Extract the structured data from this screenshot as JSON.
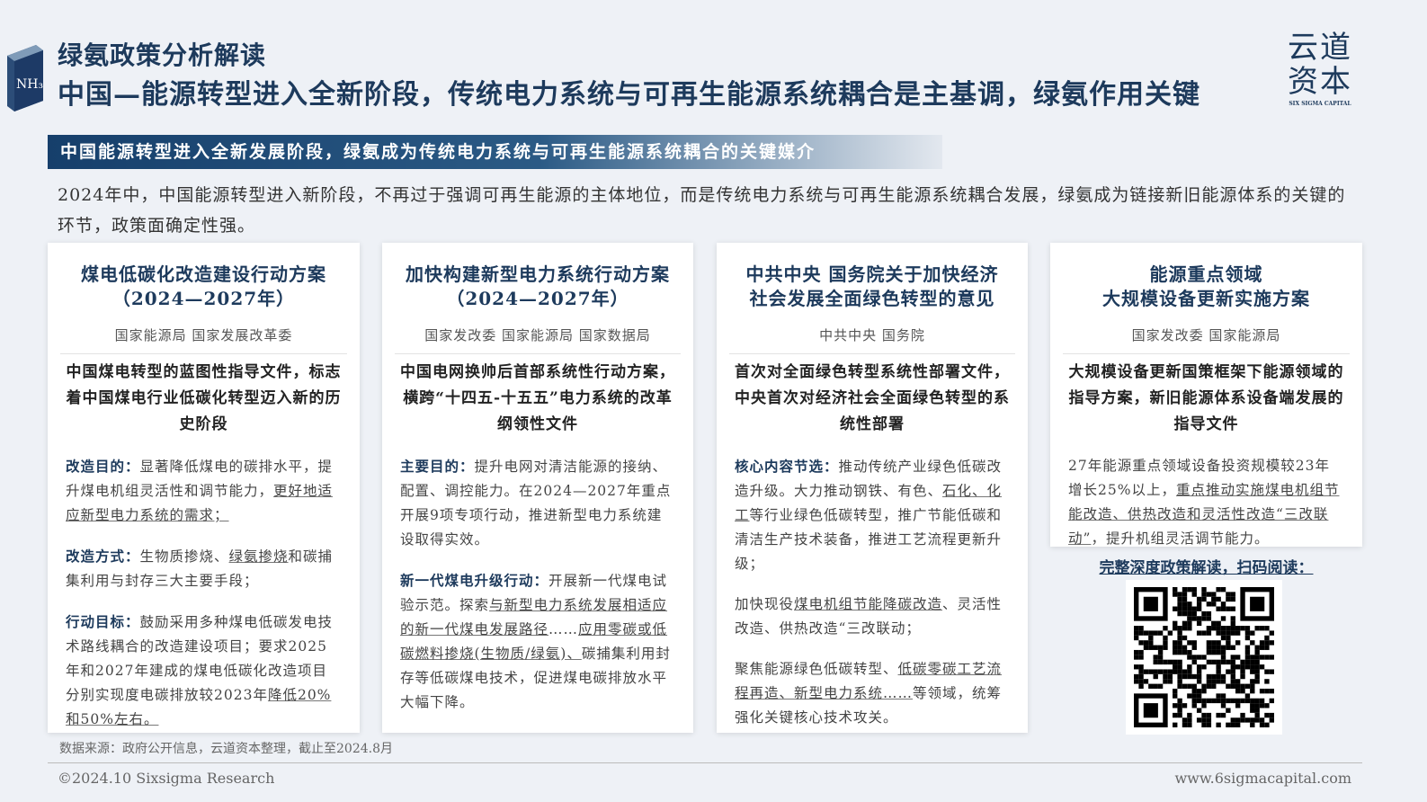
{
  "header": {
    "subtitle": "绿氨政策分析解读",
    "title": "中国—能源转型进入全新阶段，传统电力系统与可再生能源系统耦合是主基调，绿氨作用关键",
    "logo_badge": "NH₃"
  },
  "brand": {
    "cn_line1": "云道",
    "cn_line2": "资本",
    "en": "SIX SIGMA CAPITAL"
  },
  "banner": "中国能源转型进入全新发展阶段，绿氨成为传统电力系统与可再生能源系统耦合的关键媒介",
  "intro": "2024年中，中国能源转型进入新阶段，不再过于强调可再生能源的主体地位，而是传统电力系统与可再生能源系统耦合发展，绿氨成为链接新旧能源体系的关键的环节，政策面确定性强。",
  "cards": [
    {
      "title1": "煤电低碳化改造建设行动方案",
      "title2": "（2024—2027年）",
      "org": "国家能源局 国家发展改革委",
      "summary": "中国煤电转型的蓝图性指导文件，标志着中国煤电行业低碳化转型迈入新的历史阶段",
      "paras": [
        [
          {
            "t": "改造目的：",
            "s": "b"
          },
          {
            "t": "显著降低煤电的碳排水平，提升煤电机组灵活性和调节能力，"
          },
          {
            "t": "更好地适应新型电力系统的需求；",
            "s": "u"
          }
        ],
        [
          {
            "t": "改造方式：",
            "s": "b"
          },
          {
            "t": "生物质掺烧、"
          },
          {
            "t": "绿氨掺烧",
            "s": "u"
          },
          {
            "t": "和碳捕集利用与封存三大主要手段；"
          }
        ],
        [
          {
            "t": "行动目标：",
            "s": "b"
          },
          {
            "t": "鼓励采用多种煤电低碳发电技术路线耦合的改造建设项目；要求2025年和2027年建成的煤电低碳化改造项目分别实现度电碳排放较2023年"
          },
          {
            "t": "降低20%和50%左右。",
            "s": "u"
          }
        ]
      ]
    },
    {
      "title1": "加快构建新型电力系统行动方案",
      "title2": "（2024—2027年）",
      "org": "国家发改委 国家能源局 国家数据局",
      "summary": "中国电网换帅后首部系统性行动方案，横跨“十四五-十五五”电力系统的改革纲领性文件",
      "paras": [
        [
          {
            "t": "主要目的：",
            "s": "b"
          },
          {
            "t": "提升电网对清洁能源的接纳、配置、调控能力。在2024—2027年重点开展9项专项行动，推进新型电力系统建设取得实效。"
          }
        ],
        [
          {
            "t": "新一代煤电升级行动：",
            "s": "b"
          },
          {
            "t": "开展新一代煤电试验示范。探索"
          },
          {
            "t": "与新型电力系统发展相适应的新一代煤电发展路径",
            "s": "u"
          },
          {
            "t": "……"
          },
          {
            "t": "应用零碳或低碳燃料掺烧(生物质/绿氨)、",
            "s": "u"
          },
          {
            "t": "碳捕集利用封存等低碳煤电技术，促进煤电碳排放水平大幅下降。"
          }
        ]
      ]
    },
    {
      "title1": "中共中央 国务院关于加快经济",
      "title2": "社会发展全面绿色转型的意见",
      "org": "中共中央 国务院",
      "summary": "首次对全面绿色转型系统性部署文件，中央首次对经济社会全面绿色转型的系统性部署",
      "paras": [
        [
          {
            "t": "核心内容节选：",
            "s": "b"
          },
          {
            "t": "推动传统产业绿色低碳改造升级。大力推动钢铁、有色、"
          },
          {
            "t": "石化、化工",
            "s": "u"
          },
          {
            "t": "等行业绿色低碳转型，推广节能低碳和清洁生产技术装备，推进工艺流程更新升级；"
          }
        ],
        [
          {
            "t": "加快现役"
          },
          {
            "t": "煤电机组节能降碳改造",
            "s": "u"
          },
          {
            "t": "、灵活性改造、供热改造“三改联动；"
          }
        ],
        [
          {
            "t": "聚焦能源绿色低碳转型、"
          },
          {
            "t": "低碳零碳工艺流程再造、新型电力系统……",
            "s": "u"
          },
          {
            "t": "等领域，统筹强化关键核心技术攻关。"
          }
        ]
      ]
    },
    {
      "title1": "能源重点领域",
      "title2": "大规模设备更新实施方案",
      "org": "国家发改委 国家能源局",
      "summary": "大规模设备更新国策框架下能源领域的指导方案，新旧能源体系设备端发展的指导文件",
      "paras": [
        [
          {
            "t": "27年能源重点领域设备投资规模较23年增长25%以上，"
          },
          {
            "t": "重点推动实施煤电机组节能改造、供热改造和灵活性改造“三改联动”",
            "s": "u"
          },
          {
            "t": "，提升机组灵活调节能力。"
          }
        ]
      ]
    }
  ],
  "qr_label": "完整深度政策解读，扫码阅读：",
  "source": "数据来源：政府公开信息，云道资本整理，截止至2024.8月",
  "footer": {
    "copyright": "©2024.10 Sixsigma Research",
    "website": "www.6sigmacapital.com"
  }
}
